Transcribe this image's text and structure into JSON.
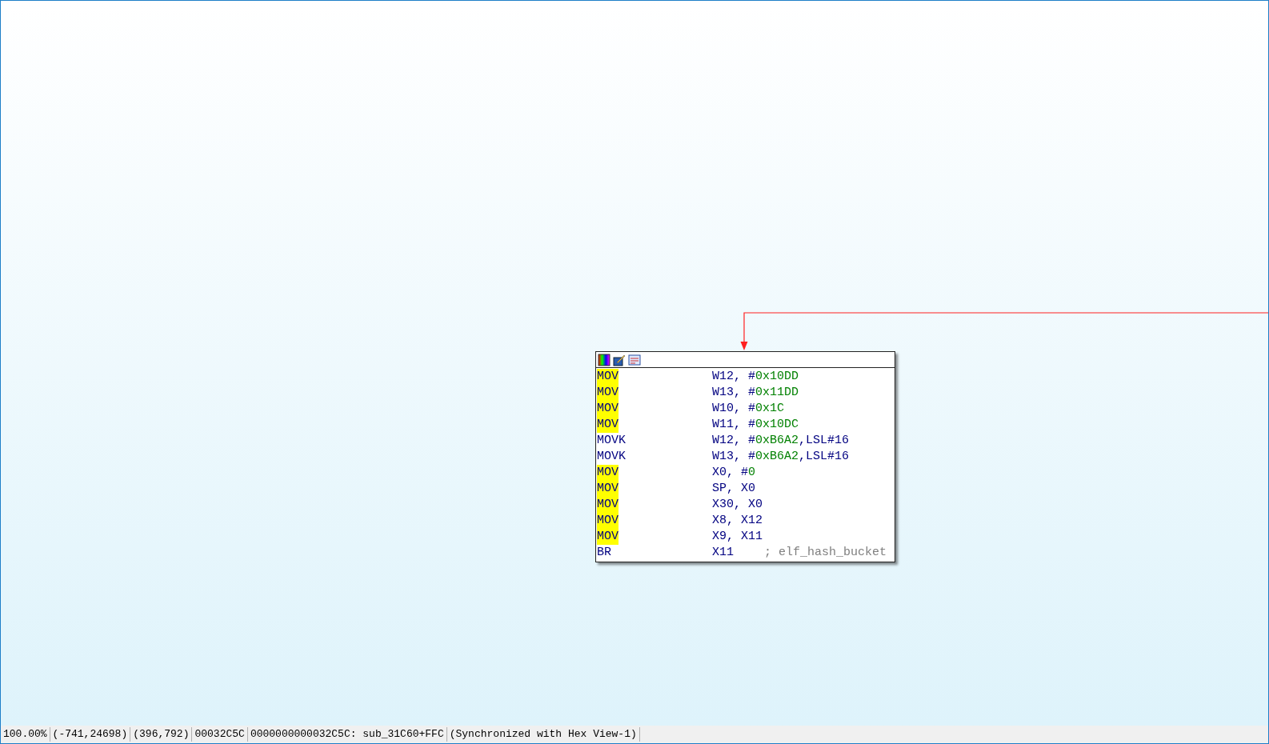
{
  "graph_node": {
    "instructions": [
      {
        "mnemonic": "MOV",
        "highlighted": true,
        "operand": [
          {
            "kind": "reg",
            "text": "W12, #"
          },
          {
            "kind": "imm",
            "text": "0x10DD"
          }
        ]
      },
      {
        "mnemonic": "MOV",
        "highlighted": true,
        "operand": [
          {
            "kind": "reg",
            "text": "W13, #"
          },
          {
            "kind": "imm",
            "text": "0x11DD"
          }
        ]
      },
      {
        "mnemonic": "MOV",
        "highlighted": true,
        "operand": [
          {
            "kind": "reg",
            "text": "W10, #"
          },
          {
            "kind": "imm",
            "text": "0x1C"
          }
        ]
      },
      {
        "mnemonic": "MOV",
        "highlighted": true,
        "operand": [
          {
            "kind": "reg",
            "text": "W11, #"
          },
          {
            "kind": "imm",
            "text": "0x10DC"
          }
        ]
      },
      {
        "mnemonic": "MOVK",
        "highlighted": false,
        "operand": [
          {
            "kind": "reg",
            "text": "W12, #"
          },
          {
            "kind": "imm",
            "text": "0xB6A2"
          },
          {
            "kind": "reg",
            "text": ",LSL#16"
          }
        ]
      },
      {
        "mnemonic": "MOVK",
        "highlighted": false,
        "operand": [
          {
            "kind": "reg",
            "text": "W13, #"
          },
          {
            "kind": "imm",
            "text": "0xB6A2"
          },
          {
            "kind": "reg",
            "text": ",LSL#16"
          }
        ]
      },
      {
        "mnemonic": "MOV",
        "highlighted": true,
        "operand": [
          {
            "kind": "reg",
            "text": "X0, #"
          },
          {
            "kind": "imm",
            "text": "0"
          }
        ]
      },
      {
        "mnemonic": "MOV",
        "highlighted": true,
        "operand": [
          {
            "kind": "reg",
            "text": "SP, X0"
          }
        ]
      },
      {
        "mnemonic": "MOV",
        "highlighted": true,
        "operand": [
          {
            "kind": "reg",
            "text": "X30, X0"
          }
        ]
      },
      {
        "mnemonic": "MOV",
        "highlighted": true,
        "operand": [
          {
            "kind": "reg",
            "text": "X8, X12"
          }
        ]
      },
      {
        "mnemonic": "MOV",
        "highlighted": true,
        "operand": [
          {
            "kind": "reg",
            "text": "X9, X11"
          }
        ]
      },
      {
        "mnemonic": "BR",
        "highlighted": false,
        "operand": [
          {
            "kind": "reg",
            "text": "X11"
          }
        ],
        "comment": "; elf_hash_bucket"
      }
    ]
  },
  "status_bar": [
    "100.00%",
    "(-741,24698)",
    "(396,792)",
    "00032C5C",
    "0000000000032C5C: sub_31C60+FFC",
    "(Synchronized with Hex View-1)"
  ]
}
